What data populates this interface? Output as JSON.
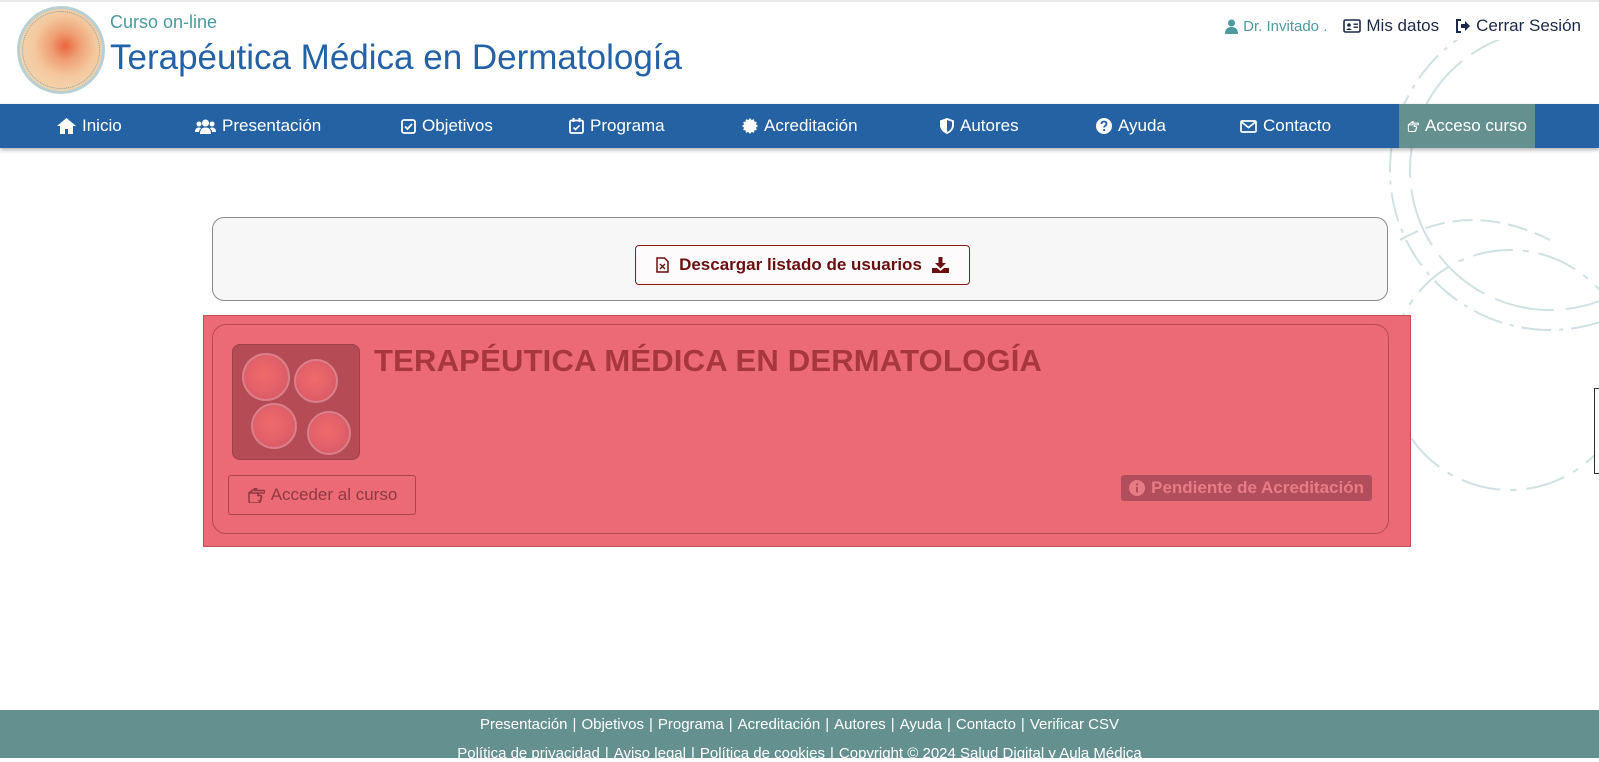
{
  "header": {
    "subtitle": "Curso on-line",
    "title": "Terapéutica Médica en Dermatología"
  },
  "user_bar": {
    "user_name": "Dr. Invitado .",
    "my_data": "Mis datos",
    "logout": "Cerrar Sesión"
  },
  "nav": {
    "items": [
      {
        "label": "Inicio",
        "icon": "home-icon"
      },
      {
        "label": "Presentación",
        "icon": "users-icon"
      },
      {
        "label": "Objetivos",
        "icon": "checkbox-icon"
      },
      {
        "label": "Programa",
        "icon": "calendar-check-icon"
      },
      {
        "label": "Acreditación",
        "icon": "badge-icon"
      },
      {
        "label": "Autores",
        "icon": "shield-icon"
      },
      {
        "label": "Ayuda",
        "icon": "question-icon"
      },
      {
        "label": "Contacto",
        "icon": "envelope-icon"
      },
      {
        "label": "Acceso curso",
        "icon": "hand-pointer-icon"
      }
    ],
    "active": "Acceso curso"
  },
  "download": {
    "label": "Descargar listado de usuarios"
  },
  "course": {
    "title": "TERAPÉUTICA MÉDICA EN DERMATOLOGÍA",
    "access_label": "Acceder al curso",
    "status": "Pendiente de Acreditación"
  },
  "footer": {
    "links": [
      "Presentación",
      "Objetivos",
      "Programa",
      "Acreditación",
      "Autores",
      "Ayuda",
      "Contacto",
      "Verificar CSV"
    ],
    "legal": [
      "Política de privacidad",
      "Aviso legal",
      "Política de cookies",
      "Copyright © 2024 Salud Digital y Aula Médica"
    ]
  },
  "colors": {
    "nav_bg": "#2562a3",
    "accent_teal": "#64908f",
    "title_blue": "#2462a8",
    "overlay_red": "#eb6a75",
    "download_text": "#6b1010"
  }
}
